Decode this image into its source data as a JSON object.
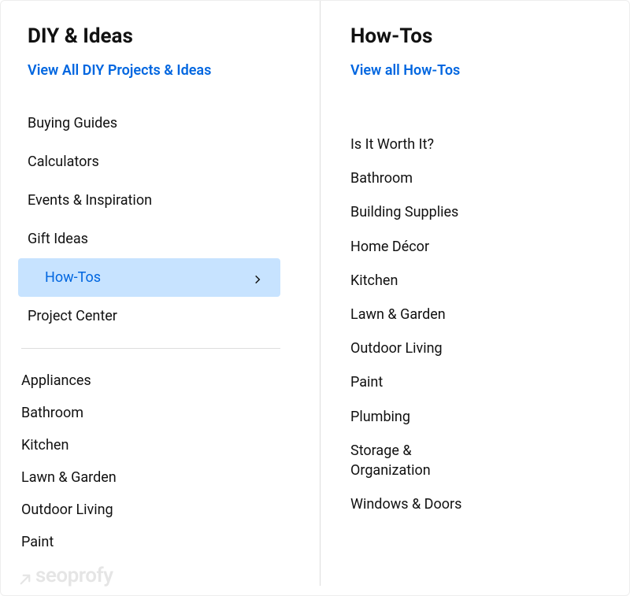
{
  "left": {
    "title": "DIY & Ideas",
    "view_all": "View All DIY Projects & Ideas",
    "primary_items": [
      {
        "label": "Buying Guides",
        "active": false,
        "has_chevron": false
      },
      {
        "label": "Calculators",
        "active": false,
        "has_chevron": false
      },
      {
        "label": "Events & Inspiration",
        "active": false,
        "has_chevron": false
      },
      {
        "label": "Gift Ideas",
        "active": false,
        "has_chevron": false
      },
      {
        "label": "How-Tos",
        "active": true,
        "has_chevron": true
      },
      {
        "label": "Project Center",
        "active": false,
        "has_chevron": false
      }
    ],
    "secondary_items": [
      {
        "label": "Appliances"
      },
      {
        "label": "Bathroom"
      },
      {
        "label": "Kitchen"
      },
      {
        "label": "Lawn & Garden"
      },
      {
        "label": "Outdoor Living"
      },
      {
        "label": "Paint"
      }
    ]
  },
  "right": {
    "title": "How-Tos",
    "view_all": "View all How-Tos",
    "items": [
      {
        "label": "Is It Worth It?"
      },
      {
        "label": "Bathroom"
      },
      {
        "label": "Building Supplies"
      },
      {
        "label": "Home Décor"
      },
      {
        "label": "Kitchen"
      },
      {
        "label": "Lawn & Garden"
      },
      {
        "label": "Outdoor Living"
      },
      {
        "label": "Paint"
      },
      {
        "label": "Plumbing"
      },
      {
        "label": "Storage & Organization"
      },
      {
        "label": "Windows & Doors"
      }
    ]
  },
  "watermark": "seoprofy"
}
